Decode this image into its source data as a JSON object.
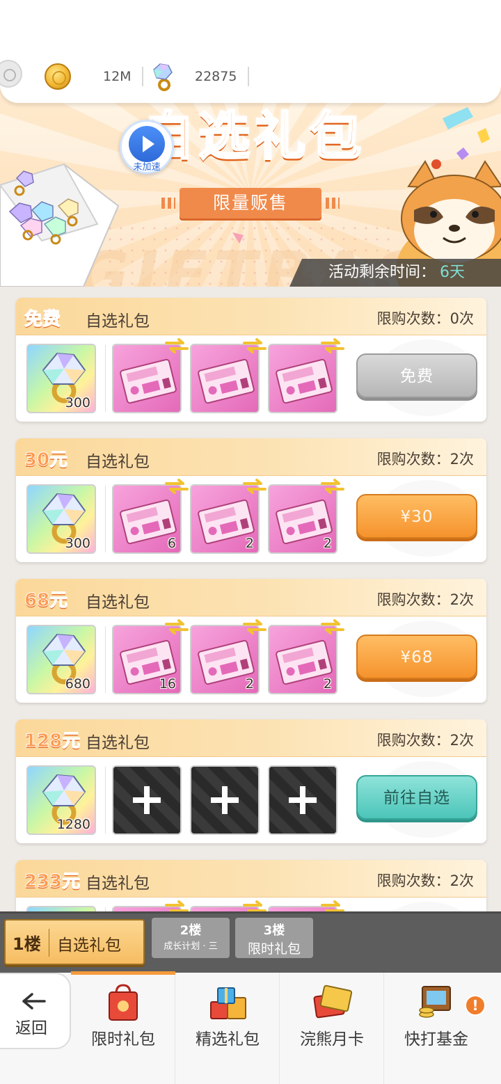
{
  "currency": {
    "coins": "12M",
    "gems": "22875"
  },
  "banner": {
    "title": "自选礼包",
    "subtitle": "限量贩售",
    "watermark": "GIFTBAG",
    "accel_label": "未加速",
    "time_label": "活动剩余时间：",
    "time_value": "6天"
  },
  "packs": [
    {
      "price": "免费",
      "name": "自选礼包",
      "limit": "限购次数：0次",
      "gem": "300",
      "items": [
        "",
        "",
        ""
      ],
      "button": "免费",
      "button_style": "gray"
    },
    {
      "price": "30元",
      "name": "自选礼包",
      "limit": "限购次数：2次",
      "gem": "300",
      "items": [
        "6",
        "2",
        "2"
      ],
      "button": "¥30",
      "button_style": "orange"
    },
    {
      "price": "68元",
      "name": "自选礼包",
      "limit": "限购次数：2次",
      "gem": "680",
      "items": [
        "16",
        "2",
        "2"
      ],
      "button": "¥68",
      "button_style": "orange"
    },
    {
      "price": "128元",
      "name": "自选礼包",
      "limit": "限购次数：2次",
      "gem": "1280",
      "items": [
        "",
        "",
        ""
      ],
      "button": "前往自选",
      "button_style": "teal"
    },
    {
      "price": "233元",
      "name": "自选礼包",
      "limit": "限购次数：2次",
      "gem": "",
      "items": [
        "",
        "",
        ""
      ],
      "button": "",
      "button_style": "orange"
    }
  ],
  "floors": [
    {
      "num": "1楼",
      "label": "自选礼包"
    },
    {
      "num": "2楼",
      "label": "成长计划 · 三"
    },
    {
      "num": "3楼",
      "label": "限时礼包"
    }
  ],
  "nav": {
    "back": "返回",
    "items": [
      "限时礼包",
      "精选礼包",
      "浣熊月卡",
      "快打基金"
    ],
    "alert": "!"
  },
  "colors": {
    "accent_orange": "#f5932d",
    "teal": "#4cc5b9",
    "header_gold": "#fbd89a"
  }
}
